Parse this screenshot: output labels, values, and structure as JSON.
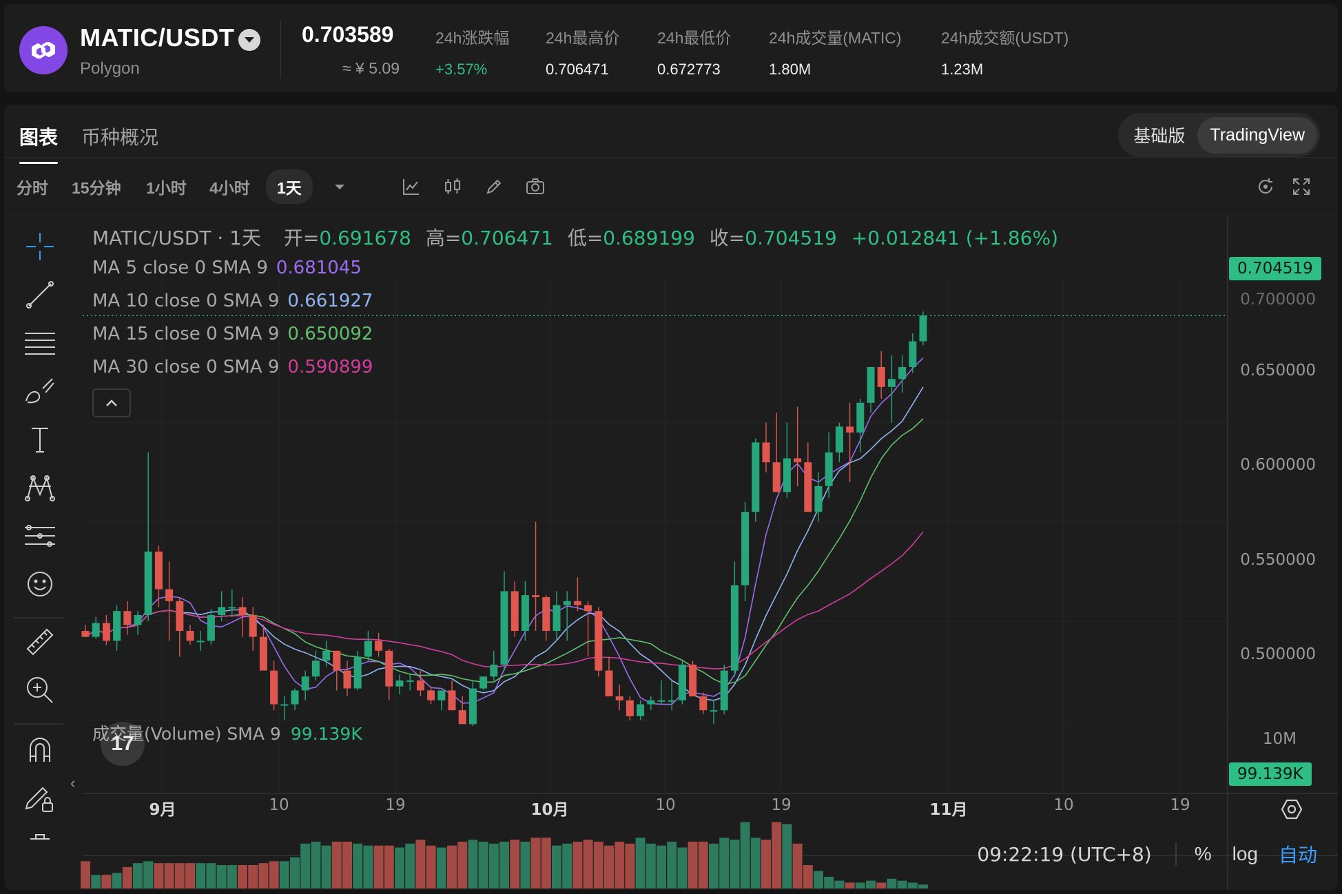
{
  "header": {
    "pair": "MATIC/USDT",
    "chain": "Polygon",
    "last_price": "0.703589",
    "cny_price": "≈ ¥ 5.09",
    "stats": [
      {
        "label": "24h涨跌幅",
        "value": "+3.57%",
        "up": true
      },
      {
        "label": "24h最高价",
        "value": "0.706471",
        "up": false
      },
      {
        "label": "24h最低价",
        "value": "0.672773",
        "up": false
      },
      {
        "label": "24h成交量(MATIC)",
        "value": "1.80M",
        "up": false
      },
      {
        "label": "24h成交额(USDT)",
        "value": "1.23M",
        "up": false
      }
    ]
  },
  "tabs": {
    "chart": "图表",
    "overview": "币种概况"
  },
  "version": {
    "basic": "基础版",
    "tradingview": "TradingView"
  },
  "intervals": [
    "分时",
    "15分钟",
    "1小时",
    "4小时",
    "1天"
  ],
  "active_interval": "1天",
  "icons": {
    "toolbar": [
      "chevron-down-icon",
      "indicators-icon",
      "candle-style-icon",
      "draw-icon",
      "screenshot-icon",
      "reset-icon",
      "fullscreen-icon"
    ],
    "drawing": [
      "crosshair-icon",
      "trend-line-icon",
      "fib-lines-icon",
      "brush-icon",
      "text-icon",
      "pattern-icon",
      "forecast-icon",
      "emoji-icon",
      "ruler-icon",
      "zoom-in-icon",
      "magnet-icon",
      "lock-drawings-icon",
      "trash-icon"
    ]
  },
  "legend": {
    "title": "MATIC/USDT · 1天",
    "open_label": "开=",
    "open": "0.691678",
    "high_label": "高=",
    "high": "0.706471",
    "low_label": "低=",
    "low": "0.689199",
    "close_label": "收=",
    "close": "0.704519",
    "change": "+0.012841 (+1.86%)",
    "ma": [
      {
        "label": "MA 5 close 0 SMA 9",
        "value": "0.681045",
        "color": "#9a6cf0"
      },
      {
        "label": "MA 10 close 0 SMA 9",
        "value": "0.661927",
        "color": "#8fb4f0"
      },
      {
        "label": "MA 15 close 0 SMA 9",
        "value": "0.650092",
        "color": "#5fbf6a"
      },
      {
        "label": "MA 30 close 0 SMA 9",
        "value": "0.590899",
        "color": "#d23d9c"
      }
    ],
    "volume_label": "成交量(Volume) SMA 9",
    "volume_value": "99.139K"
  },
  "price_axis": {
    "ticks": [
      "0.650000",
      "0.600000",
      "0.550000",
      "0.500000"
    ],
    "current": "0.704519",
    "hidden_tick": "0.700000",
    "volume_tick": "10M",
    "volume_current": "99.139K"
  },
  "time_axis": [
    {
      "label": "9月",
      "bold": true
    },
    {
      "label": "10",
      "bold": false
    },
    {
      "label": "19",
      "bold": false
    },
    {
      "label": "10月",
      "bold": true
    },
    {
      "label": "10",
      "bold": false
    },
    {
      "label": "19",
      "bold": false
    },
    {
      "label": "11月",
      "bold": true
    },
    {
      "label": "10",
      "bold": false
    },
    {
      "label": "19",
      "bold": false
    }
  ],
  "footer": {
    "clock": "09:22:19 (UTC+8)",
    "percent": "%",
    "log": "log",
    "auto": "自动"
  },
  "tv_logo": "17",
  "colors": {
    "up": "#26a67a",
    "down": "#e0574f",
    "accent": "#2ebd85",
    "brand": "#8247e5"
  },
  "chart_data": {
    "type": "candlestick",
    "interval": "1天",
    "y_range": [
      0.47,
      0.72
    ],
    "series": [
      {
        "name": "MATIC/USDT",
        "ohlc": [
          [
            0.545,
            0.548,
            0.542,
            0.542
          ],
          [
            0.542,
            0.552,
            0.541,
            0.549
          ],
          [
            0.549,
            0.553,
            0.538,
            0.54
          ],
          [
            0.54,
            0.558,
            0.535,
            0.555
          ],
          [
            0.555,
            0.56,
            0.543,
            0.548
          ],
          [
            0.548,
            0.555,
            0.543,
            0.553
          ],
          [
            0.553,
            0.635,
            0.55,
            0.585
          ],
          [
            0.585,
            0.588,
            0.557,
            0.566
          ],
          [
            0.566,
            0.58,
            0.54,
            0.56
          ],
          [
            0.56,
            0.562,
            0.532,
            0.545
          ],
          [
            0.545,
            0.548,
            0.538,
            0.54
          ],
          [
            0.54,
            0.545,
            0.535,
            0.54
          ],
          [
            0.54,
            0.556,
            0.538,
            0.553
          ],
          [
            0.553,
            0.565,
            0.55,
            0.557
          ],
          [
            0.557,
            0.566,
            0.552,
            0.557
          ],
          [
            0.557,
            0.562,
            0.542,
            0.553
          ],
          [
            0.553,
            0.557,
            0.535,
            0.542
          ],
          [
            0.542,
            0.548,
            0.525,
            0.525
          ],
          [
            0.525,
            0.53,
            0.505,
            0.508
          ],
          [
            0.508,
            0.512,
            0.5,
            0.508
          ],
          [
            0.508,
            0.516,
            0.505,
            0.515
          ],
          [
            0.515,
            0.525,
            0.51,
            0.522
          ],
          [
            0.522,
            0.535,
            0.52,
            0.53
          ],
          [
            0.53,
            0.54,
            0.527,
            0.535
          ],
          [
            0.535,
            0.534,
            0.515,
            0.525
          ],
          [
            0.525,
            0.53,
            0.512,
            0.516
          ],
          [
            0.516,
            0.535,
            0.515,
            0.532
          ],
          [
            0.532,
            0.545,
            0.53,
            0.54
          ],
          [
            0.54,
            0.544,
            0.532,
            0.535
          ],
          [
            0.535,
            0.536,
            0.51,
            0.517
          ],
          [
            0.517,
            0.523,
            0.513,
            0.52
          ],
          [
            0.52,
            0.523,
            0.515,
            0.52
          ],
          [
            0.52,
            0.525,
            0.512,
            0.515
          ],
          [
            0.515,
            0.517,
            0.508,
            0.51
          ],
          [
            0.51,
            0.515,
            0.505,
            0.515
          ],
          [
            0.515,
            0.52,
            0.505,
            0.505
          ],
          [
            0.505,
            0.512,
            0.5,
            0.498
          ],
          [
            0.498,
            0.52,
            0.497,
            0.516
          ],
          [
            0.516,
            0.522,
            0.515,
            0.522
          ],
          [
            0.522,
            0.535,
            0.52,
            0.528
          ],
          [
            0.528,
            0.575,
            0.525,
            0.565
          ],
          [
            0.565,
            0.57,
            0.542,
            0.545
          ],
          [
            0.545,
            0.57,
            0.54,
            0.563
          ],
          [
            0.563,
            0.6,
            0.545,
            0.562
          ],
          [
            0.562,
            0.563,
            0.54,
            0.545
          ],
          [
            0.545,
            0.565,
            0.54,
            0.558
          ],
          [
            0.558,
            0.565,
            0.54,
            0.56
          ],
          [
            0.56,
            0.572,
            0.555,
            0.558
          ],
          [
            0.558,
            0.56,
            0.532,
            0.555
          ],
          [
            0.555,
            0.557,
            0.522,
            0.525
          ],
          [
            0.525,
            0.532,
            0.512,
            0.512
          ],
          [
            0.512,
            0.518,
            0.505,
            0.51
          ],
          [
            0.51,
            0.512,
            0.5,
            0.502
          ],
          [
            0.502,
            0.51,
            0.5,
            0.508
          ],
          [
            0.508,
            0.512,
            0.505,
            0.51
          ],
          [
            0.51,
            0.52,
            0.508,
            0.51
          ],
          [
            0.51,
            0.52,
            0.505,
            0.51
          ],
          [
            0.51,
            0.53,
            0.508,
            0.528
          ],
          [
            0.528,
            0.53,
            0.512,
            0.512
          ],
          [
            0.512,
            0.514,
            0.503,
            0.505
          ],
          [
            0.505,
            0.51,
            0.498,
            0.505
          ],
          [
            0.505,
            0.528,
            0.503,
            0.525
          ],
          [
            0.525,
            0.58,
            0.522,
            0.568
          ],
          [
            0.568,
            0.61,
            0.56,
            0.605
          ],
          [
            0.605,
            0.642,
            0.6,
            0.64
          ],
          [
            0.64,
            0.65,
            0.625,
            0.63
          ],
          [
            0.63,
            0.655,
            0.618,
            0.615
          ],
          [
            0.615,
            0.65,
            0.612,
            0.632
          ],
          [
            0.632,
            0.658,
            0.618,
            0.63
          ],
          [
            0.63,
            0.64,
            0.605,
            0.605
          ],
          [
            0.605,
            0.625,
            0.6,
            0.618
          ],
          [
            0.618,
            0.645,
            0.612,
            0.635
          ],
          [
            0.635,
            0.65,
            0.63,
            0.648
          ],
          [
            0.648,
            0.66,
            0.62,
            0.645
          ],
          [
            0.645,
            0.662,
            0.635,
            0.66
          ],
          [
            0.66,
            0.678,
            0.655,
            0.678
          ],
          [
            0.678,
            0.686,
            0.662,
            0.668
          ],
          [
            0.668,
            0.684,
            0.65,
            0.672
          ],
          [
            0.672,
            0.684,
            0.665,
            0.678
          ],
          [
            0.678,
            0.695,
            0.675,
            0.691
          ],
          [
            0.691,
            0.706,
            0.689,
            0.704
          ]
        ]
      },
      {
        "name": "MA 5 close 0 SMA 9"
      },
      {
        "name": "MA 10 close 0 SMA 9"
      },
      {
        "name": "MA 15 close 0 SMA 9"
      },
      {
        "name": "MA 30 close 0 SMA 9"
      },
      {
        "name": "成交量(Volume) SMA 9",
        "values": [
          1.4,
          0.7,
          0.7,
          0.8,
          1.1,
          1.3,
          1.4,
          1.3,
          1.3,
          1.3,
          1.3,
          1.3,
          1.3,
          1.2,
          1.2,
          1.2,
          1.2,
          1.3,
          1.4,
          1.4,
          1.6,
          2.3,
          2.4,
          2.2,
          2.4,
          2.4,
          2.3,
          2.2,
          2.2,
          2.2,
          2.1,
          2.3,
          2.5,
          2.2,
          2.1,
          2.2,
          2.4,
          2.5,
          2.4,
          2.3,
          2.4,
          2.5,
          2.4,
          2.6,
          2.6,
          2.2,
          2.3,
          2.4,
          2.5,
          2.4,
          2.2,
          2.4,
          2.3,
          2.6,
          2.3,
          2.2,
          2.4,
          2.1,
          2.4,
          2.4,
          2.3,
          2.6,
          2.5,
          3.4,
          2.6,
          2.5,
          3.4,
          3.3,
          2.3,
          1.2,
          0.9,
          0.6,
          0.4,
          0.3,
          0.3,
          0.4,
          0.3,
          0.5,
          0.4,
          0.3,
          0.2
        ]
      }
    ]
  }
}
